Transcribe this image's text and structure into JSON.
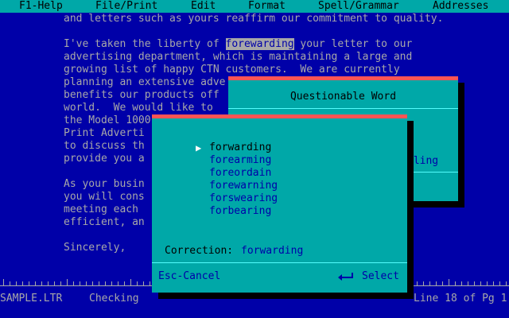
{
  "menu": {
    "help": "F1-Help",
    "file_print": "File/Print",
    "edit": "Edit",
    "format": "Format",
    "spell_grammar": "Spell/Grammar",
    "addresses": "Addresses"
  },
  "document": {
    "lines": [
      "and letters such as yours reaffirm our commitment to quality.",
      "",
      "I've taken the liberty of ",
      "advertising department, which is maintaining a large and",
      "growing list of happy CTN customers.  We are currently",
      "planning an extensive adve",
      "benefits our products off",
      "world.  We would like to",
      "the Model 1000",
      "Print Adverti",
      "to discuss th",
      "provide you a",
      "",
      "As your busin",
      "you will cons",
      "meeting each",
      "efficient, an",
      "",
      "Sincerely,"
    ],
    "flagged_word": "forewarding",
    "line3_rest": " your letter to our"
  },
  "status": {
    "filename": "SAMPLE.LTR",
    "mode": "Checking",
    "position": "Line 18 of Pg 1"
  },
  "questionable_dialog": {
    "title": "Questionable Word",
    "partial_text": "lling"
  },
  "suggestions_dialog": {
    "suggestions": [
      "forwarding",
      "forearming",
      "foreordain",
      "forewarning",
      "forswearing",
      "forbearing"
    ],
    "selected_index": 0,
    "correction_label": "Correction:",
    "correction_value": "forwarding",
    "esc_label": "Esc-Cancel",
    "select_label": "Select"
  },
  "colors": {
    "background": "#0000a8",
    "menu_bar": "#00a8a8",
    "dialog": "#00a8a8",
    "dialog_top_border": "#fc5454",
    "text_gray": "#a8a8a8"
  }
}
